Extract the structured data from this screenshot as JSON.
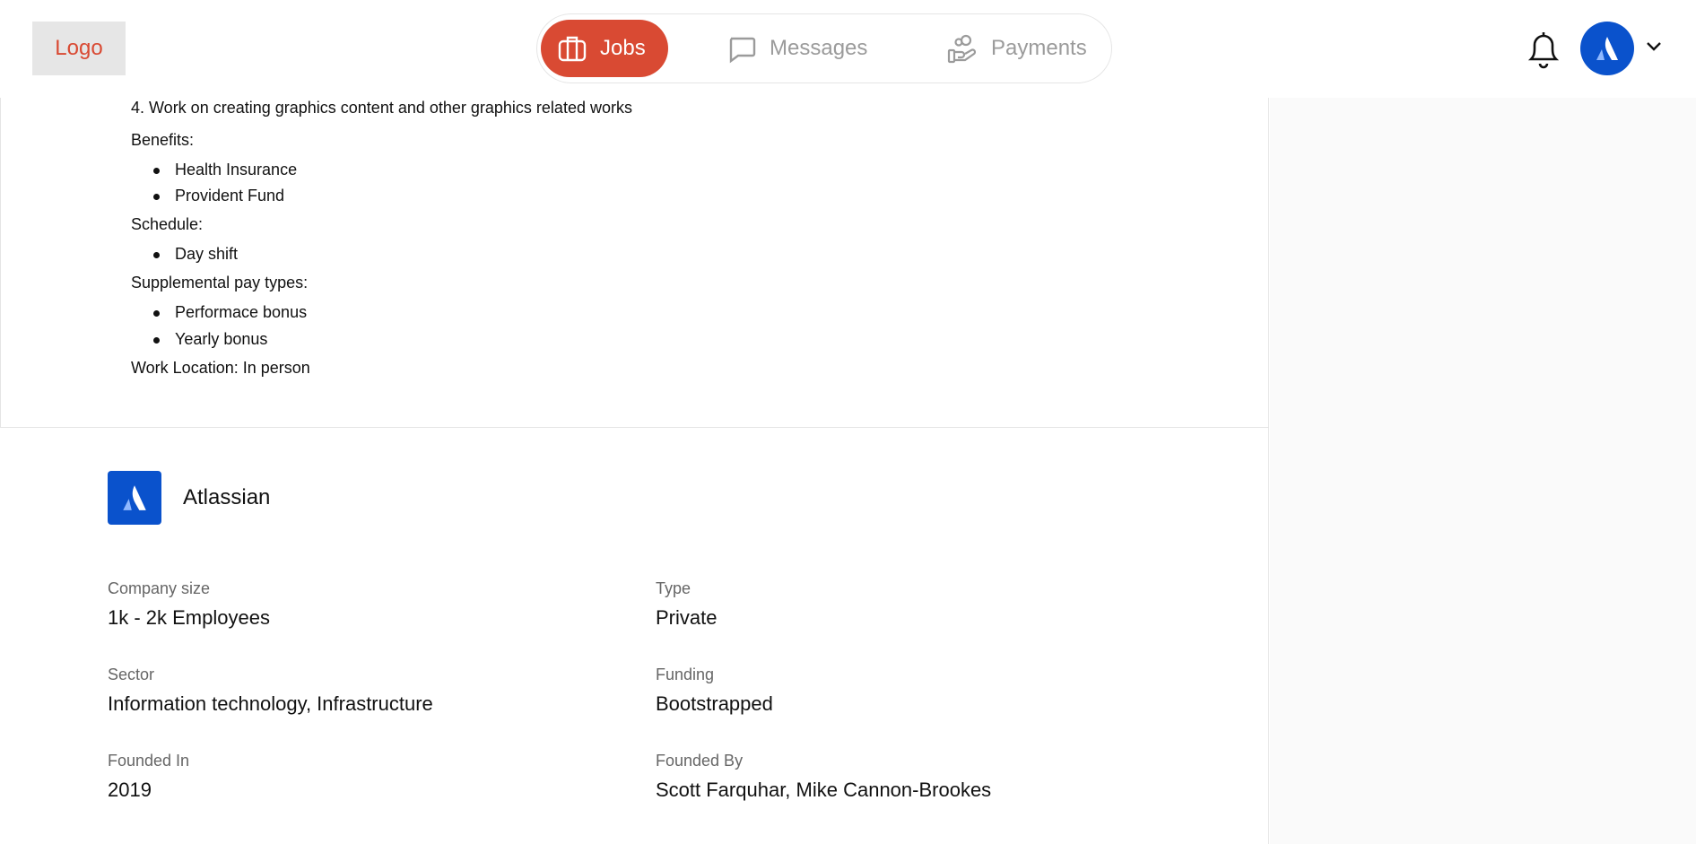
{
  "header": {
    "logo": "Logo",
    "nav": [
      {
        "label": "Jobs",
        "icon": "briefcase-icon",
        "active": true
      },
      {
        "label": "Messages",
        "icon": "chat-bubble-icon",
        "active": false
      },
      {
        "label": "Payments",
        "icon": "hand-coins-icon",
        "active": false
      }
    ],
    "notifications_icon": "bell-icon",
    "avatar_icon": "atlassian-logo-icon",
    "menu_icon": "chevron-down-icon"
  },
  "description": {
    "line_4": "4. Work on creating graphics content and other graphics related works",
    "benefits_label": "Benefits:",
    "benefits": [
      "Health Insurance",
      "Provident Fund"
    ],
    "schedule_label": "Schedule:",
    "schedule": [
      "Day shift"
    ],
    "supplemental_label": "Supplemental pay types:",
    "supplemental": [
      "Performace bonus",
      "Yearly bonus"
    ],
    "work_location": "Work Location: In person"
  },
  "company": {
    "name": "Atlassian",
    "fields": [
      {
        "label": "Company size",
        "value": "1k - 2k Employees"
      },
      {
        "label": "Type",
        "value": "Private"
      },
      {
        "label": "Sector",
        "value": "Information technology, Infrastructure"
      },
      {
        "label": "Funding",
        "value": "Bootstrapped"
      },
      {
        "label": "Founded In",
        "value": "2019"
      },
      {
        "label": "Founded By",
        "value": "Scott Farquhar, Mike Cannon-Brookes"
      }
    ]
  },
  "colors": {
    "accent": "#d94a33",
    "brand_blue": "#0a52cc",
    "muted_text": "#666666",
    "border": "#e5e5e5",
    "sidebar_bg": "#fafafa"
  }
}
